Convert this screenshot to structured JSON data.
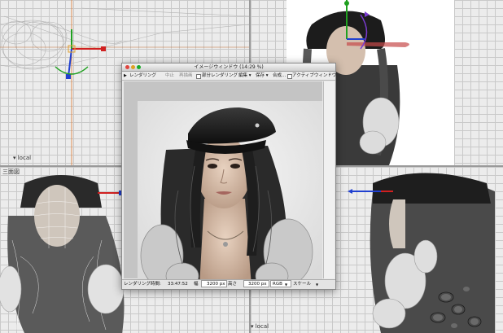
{
  "viewports": {
    "top_left": {
      "label": "▾ local"
    },
    "top_right": {
      "label": ""
    },
    "bottom_left": {
      "label": "三面図"
    },
    "bottom_right": {
      "label": "▾ local"
    }
  },
  "render_window": {
    "title": "イメージウィンドウ (14:29 %)",
    "menu": {
      "rendering": "レンダリング",
      "stop": "中止",
      "redraw": "再描画",
      "partial_rendering": "部分レンダリング",
      "edit": "編集 ▾",
      "save": "保存 ▾",
      "composite": "合成...",
      "active_window": "アクティブウィンドウ"
    },
    "status": {
      "render_time_label": "レンダリング時間:",
      "render_time_value": "33:47:52",
      "width_label": "幅",
      "width_value": "3200 px",
      "height_label": "高さ",
      "height_value": "3200 px",
      "color_mode": "RGB",
      "scale_label": "スケール"
    }
  },
  "colors": {
    "axis_x": "#d02020",
    "axis_y": "#20a020",
    "axis_z": "#2040d0",
    "manipulator_purple": "#7a3bd0"
  }
}
